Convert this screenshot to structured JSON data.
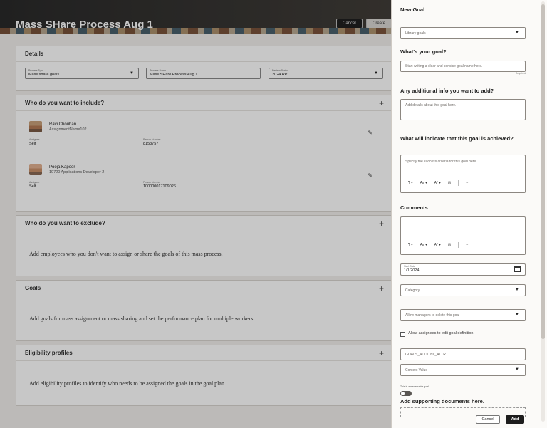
{
  "header": {
    "title": "Mass SHare Process Aug 1",
    "cancel_label": "Cancel",
    "create_label": "Create"
  },
  "details": {
    "heading": "Details",
    "process_type_label": "Process Type",
    "process_type_value": "Mass share goals",
    "process_name_label": "Process Name",
    "process_name_value": "Mass SHare Process Aug 1",
    "review_period_label": "Review Period",
    "review_period_value": "2024 RP"
  },
  "include": {
    "heading": "Who do you want to include?",
    "people": [
      {
        "name": "Ravi Chouhan",
        "assignment": "AssignmentName102",
        "assignee_label": "Assignee",
        "assignee_value": "Self",
        "person_number_label": "Person Number",
        "person_number_value": "8153757"
      },
      {
        "name": "Pooja Kapoor",
        "assignment": "10720 Applications Developer 2",
        "assignee_label": "Assignee",
        "assignee_value": "Self",
        "person_number_label": "Person Number",
        "person_number_value": "100000017109026"
      }
    ]
  },
  "exclude": {
    "heading": "Who do you want to exclude?",
    "message": "Add employees who you don't want to assign or share the goals of this mass process."
  },
  "goals": {
    "heading": "Goals",
    "message": "Add goals for mass assignment or mass sharing and set the performance plan for multiple workers."
  },
  "eligibility": {
    "heading": "Eligibility profiles",
    "message": "Add eligibility profiles to identify who needs to be assigned the goals in the goal plan."
  },
  "panel": {
    "title": "New Goal",
    "library_placeholder": "Library goals",
    "goal_heading": "What's your goal?",
    "goal_placeholder": "Start writing a clear and concise goal name here.",
    "required_label": "Required",
    "additional_heading": "Any additional info you want to add?",
    "additional_placeholder": "Add details about this goal here.",
    "success_heading": "What will indicate that this goal is achieved?",
    "success_placeholder": "Specify the success criteria for this goal here.",
    "comments_heading": "Comments",
    "start_date_label": "Start Date",
    "start_date_value": "1/1/2024",
    "category_placeholder": "Category",
    "allow_delete_placeholder": "Allow managers to delete this goal",
    "allow_edit_label": "Allow assignees to edit goal definition",
    "addl_attr_placeholder": "GOALS_ADDITNL_ATTR",
    "context_value_placeholder": "Context Value",
    "measurable_label": "This is a measurable goal",
    "supporting_docs_heading": "Add supporting documents here.",
    "cancel_label": "Cancel",
    "add_label": "Add"
  },
  "toolbar": {
    "paragraph_icon": "¶",
    "font_size_icon": "Aa",
    "text_color_icon": "A°",
    "list_icon": "⊟",
    "more_icon": "···"
  }
}
